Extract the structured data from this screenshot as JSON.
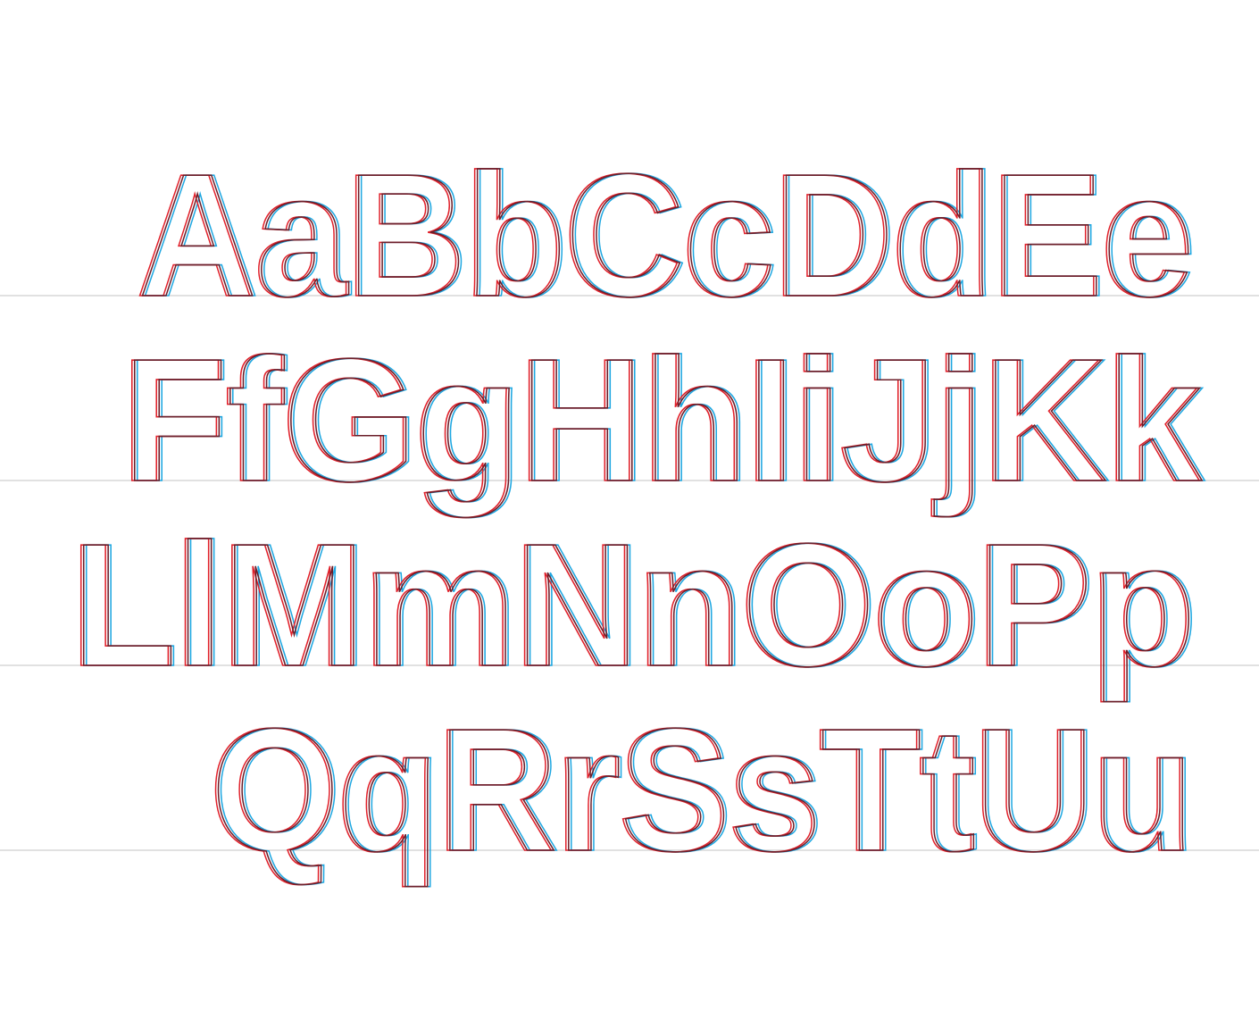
{
  "specimen": {
    "rows": [
      "AaBbCcDdEe",
      "FfGgHhIiJjKk",
      "LlMmNnOoPp",
      "QqRrSsTtUu"
    ],
    "colors": {
      "background": "#ffffff",
      "baseline": "#cfcfcf",
      "outline_a": "#1ea7e1",
      "outline_b": "#e0202a",
      "outline_overlap": "#6b1f2a"
    }
  }
}
